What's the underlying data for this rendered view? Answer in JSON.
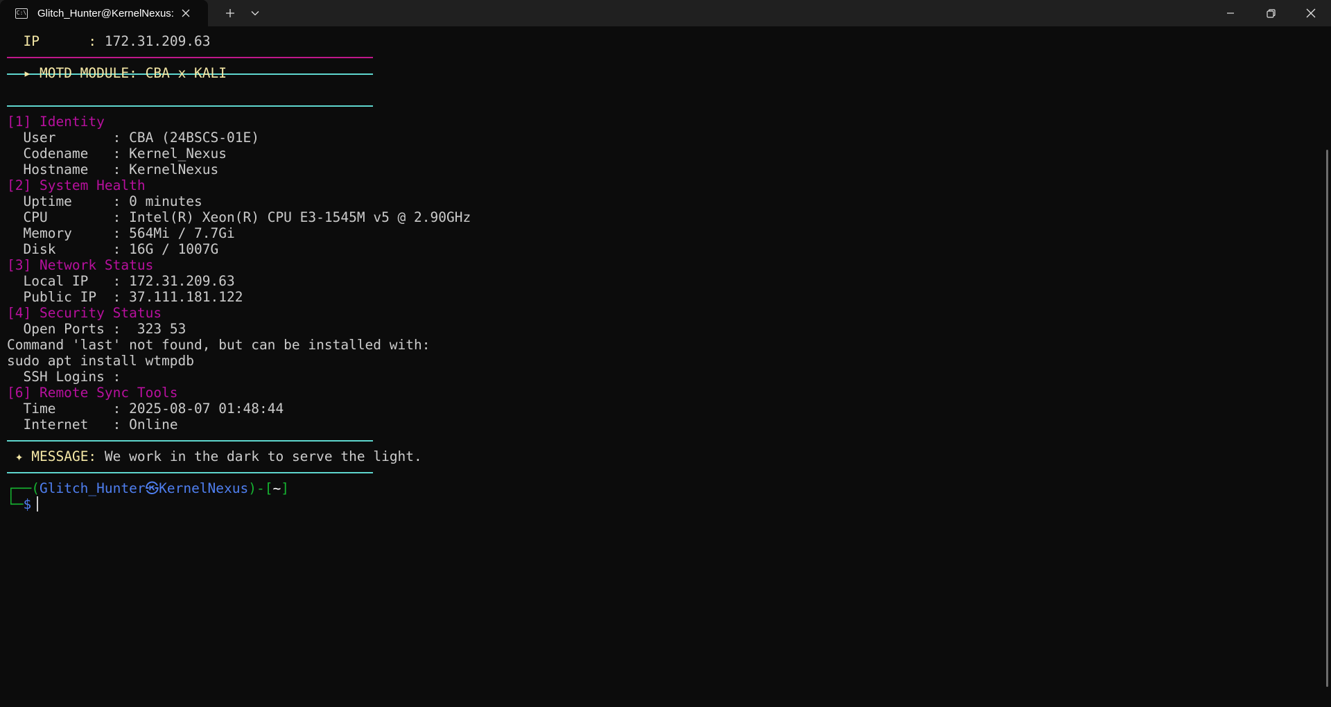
{
  "window": {
    "tab_title": "Glitch_Hunter@KernelNexus:",
    "tab_icon": "terminal-icon",
    "new_tab_icon": "plus-icon",
    "dropdown_icon": "chevron-down-icon",
    "minimize_icon": "minimize-icon",
    "restore_icon": "restore-icon",
    "close_icon": "close-icon"
  },
  "terminal": {
    "ip_line": {
      "label": "IP      :",
      "value": "172.31.209.63"
    },
    "motd_header": {
      "marker": "▸",
      "text": "MOTD MODULE: CBA x KALI"
    },
    "sections": {
      "identity": {
        "header": "[1] Identity",
        "rows": [
          {
            "label": "User       :",
            "value": "CBA (24BSCS-01E)"
          },
          {
            "label": "Codename   :",
            "value": "Kernel_Nexus"
          },
          {
            "label": "Hostname   :",
            "value": "KernelNexus"
          }
        ]
      },
      "system_health": {
        "header": "[2] System Health",
        "rows": [
          {
            "label": "Uptime     :",
            "value": "0 minutes"
          },
          {
            "label": "CPU        :",
            "value": "Intel(R) Xeon(R) CPU E3-1545M v5 @ 2.90GHz"
          },
          {
            "label": "Memory     :",
            "value": "564Mi / 7.7Gi"
          },
          {
            "label": "Disk       :",
            "value": "16G / 1007G"
          }
        ]
      },
      "network_status": {
        "header": "[3] Network Status",
        "rows": [
          {
            "label": "Local IP   :",
            "value": "172.31.209.63"
          },
          {
            "label": "Public IP  :",
            "value": "37.111.181.122"
          }
        ]
      },
      "security_status": {
        "header": "[4] Security Status",
        "open_ports": {
          "label": "Open Ports :",
          "value": " 323 53"
        },
        "error_line_1": "Command 'last' not found, but can be installed with:",
        "error_line_2": "sudo apt install wtmpdb",
        "ssh_logins": {
          "label": "SSH Logins :",
          "value": ""
        }
      },
      "remote_sync": {
        "header": "[6] Remote Sync Tools",
        "rows": [
          {
            "label": "Time       :",
            "value": "2025-08-07 01:48:44"
          },
          {
            "label": "Internet   :",
            "value": "Online"
          }
        ]
      }
    },
    "message": {
      "marker": "✦",
      "label": "MESSAGE:",
      "text": "We work in the dark to serve the light."
    },
    "prompt": {
      "line1_prefix": "┌──(",
      "user": "Glitch_Hunter",
      "at_symbol": "㉿",
      "host": "KernelNexus",
      "mid": ")-[",
      "cwd": "~",
      "end": "]",
      "line2_prefix": "└─",
      "dollar": "$"
    }
  },
  "colors": {
    "background": "#0c0c0c",
    "titlebar": "#202020",
    "text": "#cccccc",
    "yellow": "#f5e8a6",
    "magenta": "#b8109e",
    "cyan_rule": "#5fd7cf",
    "magenta_rule": "#c0178a",
    "blue": "#4f7ff0",
    "green": "#16b531"
  }
}
